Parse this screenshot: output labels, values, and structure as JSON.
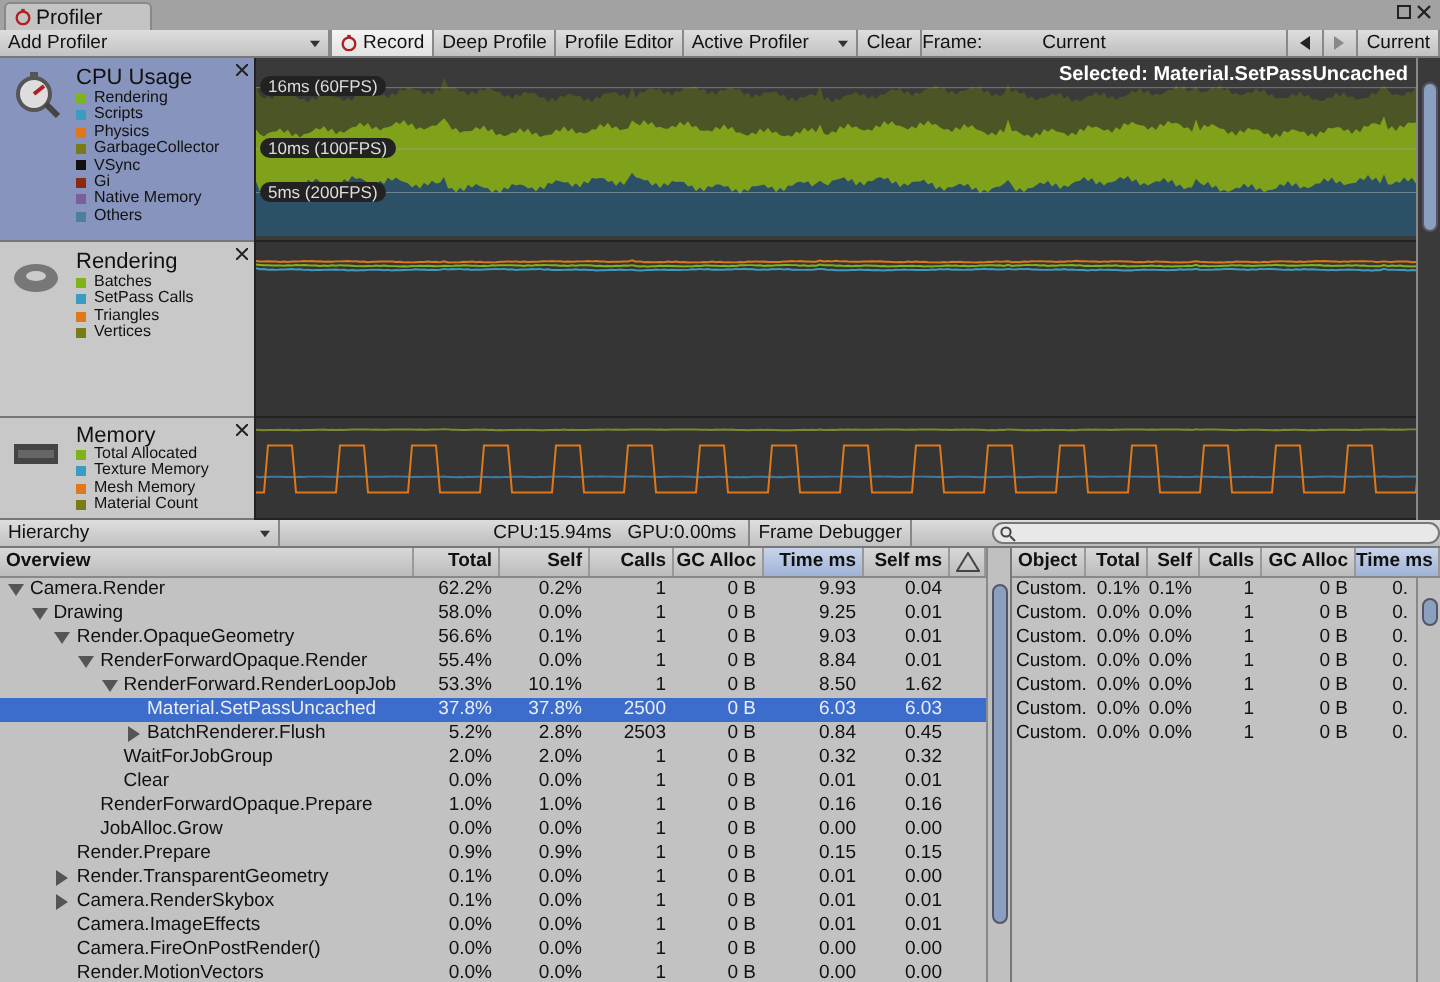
{
  "window": {
    "tab": "Profiler"
  },
  "toolbar": {
    "add_profiler": "Add Profiler",
    "buttons": [
      {
        "label": "Record",
        "on": true,
        "kind": "record"
      },
      {
        "label": "Deep Profile",
        "on": false,
        "kind": "toggle"
      },
      {
        "label": "Profile Editor",
        "on": false,
        "kind": "toggle"
      }
    ],
    "active_profiler": "Active Profiler",
    "clear": "Clear",
    "frame_label": "Frame:",
    "frame_value": "Current",
    "current_button": "Current"
  },
  "modules": [
    {
      "kind": "cpu",
      "title": "CPU Usage",
      "selected": true,
      "legend": [
        {
          "label": "Rendering",
          "color": "#7fb31a"
        },
        {
          "label": "Scripts",
          "color": "#3b9bc0"
        },
        {
          "label": "Physics",
          "color": "#e0781a"
        },
        {
          "label": "GarbageCollector",
          "color": "#7a7a18"
        },
        {
          "label": "VSync",
          "color": "#111111"
        },
        {
          "label": "Gi",
          "color": "#8a2a10"
        },
        {
          "label": "Native Memory",
          "color": "#7b5e9e"
        },
        {
          "label": "Others",
          "color": "#4a7fa0"
        }
      ]
    },
    {
      "kind": "rendering",
      "title": "Rendering",
      "selected": false,
      "legend": [
        {
          "label": "Batches",
          "color": "#7fb31a"
        },
        {
          "label": "SetPass Calls",
          "color": "#3b9bc0"
        },
        {
          "label": "Triangles",
          "color": "#e0781a"
        },
        {
          "label": "Vertices",
          "color": "#7a7a18"
        }
      ]
    },
    {
      "kind": "memory",
      "title": "Memory",
      "selected": false,
      "legend": [
        {
          "label": "Total Allocated",
          "color": "#7fb31a"
        },
        {
          "label": "Texture Memory",
          "color": "#3b9bc0"
        },
        {
          "label": "Mesh Memory",
          "color": "#e0781a"
        },
        {
          "label": "Material Count",
          "color": "#7a7a18"
        }
      ]
    }
  ],
  "cpu_graph": {
    "selected_label": "Selected: Material.SetPassUncached",
    "markers": [
      "16ms (60FPS)",
      "10ms (100FPS)",
      "5ms (200FPS)"
    ]
  },
  "hierarchy_toolbar": {
    "view": "Hierarchy",
    "cpu": "CPU:15.94ms",
    "gpu": "GPU:0.00ms",
    "frame_debugger": "Frame Debugger"
  },
  "hierarchy": {
    "columns": [
      {
        "label": "Overview",
        "selected": false
      },
      {
        "label": "Total",
        "selected": false
      },
      {
        "label": "Self",
        "selected": false
      },
      {
        "label": "Calls",
        "selected": false
      },
      {
        "label": "GC Alloc",
        "selected": false
      },
      {
        "label": "Time ms",
        "selected": true
      },
      {
        "label": "Self ms",
        "selected": false
      }
    ],
    "rows": [
      {
        "name": "Camera.Render",
        "total": "62.2%",
        "self": "0.2%",
        "calls": "1",
        "gc_alloc": "0 B",
        "time_ms": "9.93",
        "self_ms": "0.04",
        "selected": false,
        "expanded": true,
        "children": [
          {
            "name": "Drawing",
            "total": "58.0%",
            "self": "0.0%",
            "calls": "1",
            "gc_alloc": "0 B",
            "time_ms": "9.25",
            "self_ms": "0.01",
            "selected": false,
            "expanded": true,
            "children": [
              {
                "name": "Render.OpaqueGeometry",
                "total": "56.6%",
                "self": "0.1%",
                "calls": "1",
                "gc_alloc": "0 B",
                "time_ms": "9.03",
                "self_ms": "0.01",
                "selected": false,
                "expanded": true,
                "children": [
                  {
                    "name": "RenderForwardOpaque.Render",
                    "total": "55.4%",
                    "self": "0.0%",
                    "calls": "1",
                    "gc_alloc": "0 B",
                    "time_ms": "8.84",
                    "self_ms": "0.01",
                    "selected": false,
                    "expanded": true,
                    "children": [
                      {
                        "name": "RenderForward.RenderLoopJob",
                        "total": "53.3%",
                        "self": "10.1%",
                        "calls": "1",
                        "gc_alloc": "0 B",
                        "time_ms": "8.50",
                        "self_ms": "1.62",
                        "selected": false,
                        "expanded": true,
                        "children": [
                          {
                            "name": "Material.SetPassUncached",
                            "total": "37.8%",
                            "self": "37.8%",
                            "calls": "2500",
                            "gc_alloc": "0 B",
                            "time_ms": "6.03",
                            "self_ms": "6.03",
                            "selected": true
                          },
                          {
                            "name": "BatchRenderer.Flush",
                            "total": "5.2%",
                            "self": "2.8%",
                            "calls": "2503",
                            "gc_alloc": "0 B",
                            "time_ms": "0.84",
                            "self_ms": "0.45",
                            "selected": false,
                            "expanded": false
                          }
                        ]
                      },
                      {
                        "name": "WaitForJobGroup",
                        "total": "2.0%",
                        "self": "2.0%",
                        "calls": "1",
                        "gc_alloc": "0 B",
                        "time_ms": "0.32",
                        "self_ms": "0.32",
                        "selected": false
                      },
                      {
                        "name": "Clear",
                        "total": "0.0%",
                        "self": "0.0%",
                        "calls": "1",
                        "gc_alloc": "0 B",
                        "time_ms": "0.01",
                        "self_ms": "0.01",
                        "selected": false
                      }
                    ]
                  },
                  {
                    "name": "RenderForwardOpaque.Prepare",
                    "total": "1.0%",
                    "self": "1.0%",
                    "calls": "1",
                    "gc_alloc": "0 B",
                    "time_ms": "0.16",
                    "self_ms": "0.16",
                    "selected": false
                  },
                  {
                    "name": "JobAlloc.Grow",
                    "total": "0.0%",
                    "self": "0.0%",
                    "calls": "1",
                    "gc_alloc": "0 B",
                    "time_ms": "0.00",
                    "self_ms": "0.00",
                    "selected": false
                  }
                ]
              },
              {
                "name": "Render.Prepare",
                "total": "0.9%",
                "self": "0.9%",
                "calls": "1",
                "gc_alloc": "0 B",
                "time_ms": "0.15",
                "self_ms": "0.15",
                "selected": false
              },
              {
                "name": "Render.TransparentGeometry",
                "total": "0.1%",
                "self": "0.0%",
                "calls": "1",
                "gc_alloc": "0 B",
                "time_ms": "0.01",
                "self_ms": "0.00",
                "selected": false,
                "expanded": false
              },
              {
                "name": "Camera.RenderSkybox",
                "total": "0.1%",
                "self": "0.0%",
                "calls": "1",
                "gc_alloc": "0 B",
                "time_ms": "0.01",
                "self_ms": "0.01",
                "selected": false,
                "expanded": false
              },
              {
                "name": "Camera.ImageEffects",
                "total": "0.0%",
                "self": "0.0%",
                "calls": "1",
                "gc_alloc": "0 B",
                "time_ms": "0.01",
                "self_ms": "0.01",
                "selected": false
              },
              {
                "name": "Camera.FireOnPostRender()",
                "total": "0.0%",
                "self": "0.0%",
                "calls": "1",
                "gc_alloc": "0 B",
                "time_ms": "0.00",
                "self_ms": "0.00",
                "selected": false
              },
              {
                "name": "Render.MotionVectors",
                "total": "0.0%",
                "self": "0.0%",
                "calls": "1",
                "gc_alloc": "0 B",
                "time_ms": "0.00",
                "self_ms": "0.00",
                "selected": false
              }
            ]
          }
        ]
      }
    ]
  },
  "objects": {
    "columns": [
      {
        "label": "Object",
        "selected": false
      },
      {
        "label": "Total",
        "selected": false
      },
      {
        "label": "Self",
        "selected": false
      },
      {
        "label": "Calls",
        "selected": false
      },
      {
        "label": "GC Alloc",
        "selected": false
      },
      {
        "label": "Time ms",
        "selected": true
      }
    ],
    "rows": [
      {
        "object": "Custom.",
        "total": "0.1%",
        "self": "0.1%",
        "calls": "1",
        "gc_alloc": "0 B",
        "time_ms": "0."
      },
      {
        "object": "Custom.",
        "total": "0.0%",
        "self": "0.0%",
        "calls": "1",
        "gc_alloc": "0 B",
        "time_ms": "0."
      },
      {
        "object": "Custom.",
        "total": "0.0%",
        "self": "0.0%",
        "calls": "1",
        "gc_alloc": "0 B",
        "time_ms": "0."
      },
      {
        "object": "Custom.",
        "total": "0.0%",
        "self": "0.0%",
        "calls": "1",
        "gc_alloc": "0 B",
        "time_ms": "0."
      },
      {
        "object": "Custom.",
        "total": "0.0%",
        "self": "0.0%",
        "calls": "1",
        "gc_alloc": "0 B",
        "time_ms": "0."
      },
      {
        "object": "Custom.",
        "total": "0.0%",
        "self": "0.0%",
        "calls": "1",
        "gc_alloc": "0 B",
        "time_ms": "0."
      },
      {
        "object": "Custom.",
        "total": "0.0%",
        "self": "0.0%",
        "calls": "1",
        "gc_alloc": "0 B",
        "time_ms": "0."
      }
    ]
  }
}
